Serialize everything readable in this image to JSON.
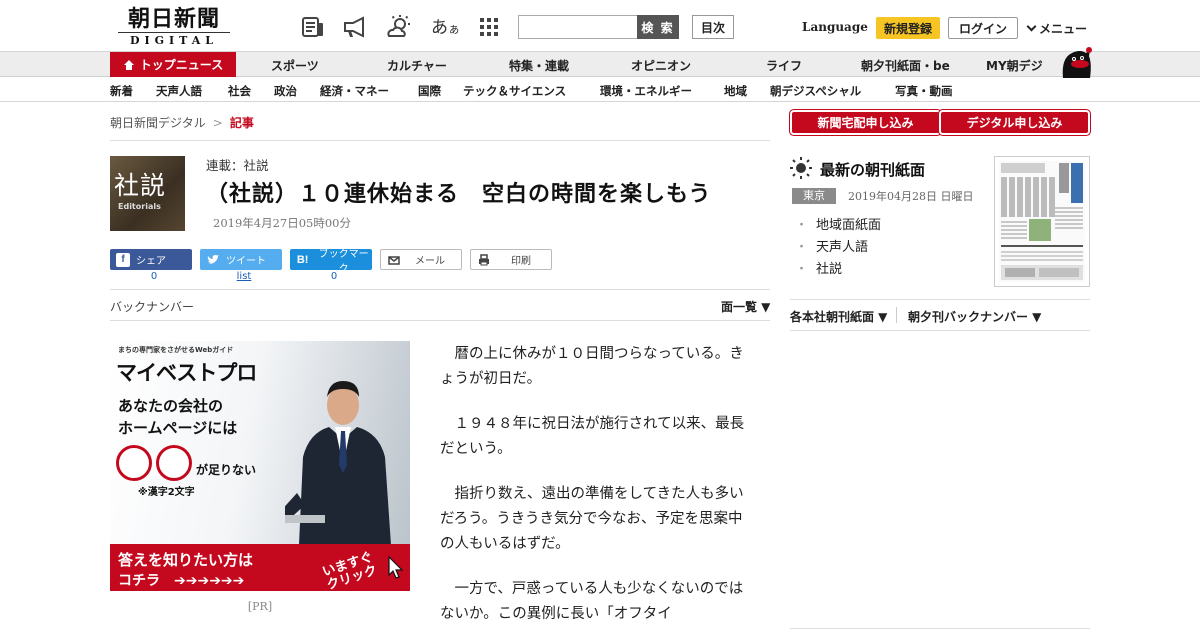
{
  "header": {
    "logo_main": "朝日新聞",
    "logo_sub": "DIGITAL",
    "search_button": "検 索",
    "search_placeholder": "",
    "toc_button": "目次",
    "language": "Language",
    "register": "新規登録",
    "login": "ログイン",
    "menu": "メニュー",
    "font_size_glyph": "あ",
    "font_size_glyph_small": "ぁ",
    "icons": [
      "paper-icon",
      "megaphone-icon",
      "weather-icon",
      "font-size-icon",
      "grid-icon"
    ]
  },
  "nav_primary": {
    "top": "トップニュース",
    "items": [
      "スポーツ",
      "カルチャー",
      "特集・連載",
      "オピニオン",
      "ライフ",
      "朝夕刊紙面・be",
      "MY朝デジ"
    ]
  },
  "nav_secondary": {
    "items": [
      "新着",
      "天声人語",
      "社会",
      "政治",
      "経済・マネー",
      "国際",
      "テック＆サイエンス",
      "環境・エネルギー",
      "地域",
      "朝デジスペシャル",
      "写真・動画"
    ]
  },
  "breadcrumb": {
    "home": "朝日新聞デジタル",
    "separator": ">",
    "current": "記事"
  },
  "article": {
    "badge_kanji": "社説",
    "badge_en": "Editorials",
    "series": "連載：社説",
    "title": "（社説）１０連休始まる　空白の時間を楽しもう",
    "date": "2019年4月27日05時00分",
    "paragraphs": [
      "　暦の上に休みが１０日間つらなっている。きょうが初日だ。",
      "　１９４８年に祝日法が施行されて以来、最長だという。",
      "　指折り数え、遠出の準備をしてきた人も多いだろう。うきうき気分で今なお、予定を思案中の人もいるはずだ。",
      "　一方で、戸惑っている人も少なくないのではないか。この異例に長い「オフタイ"
    ]
  },
  "share": {
    "facebook": {
      "label": "シェア",
      "count": "0"
    },
    "twitter": {
      "label": "ツイート",
      "count": "list"
    },
    "hatena": {
      "label": "ブックマーク",
      "count": "0"
    },
    "mail": {
      "label": "メール"
    },
    "print": {
      "label": "印刷"
    }
  },
  "backnumber": {
    "label": "バックナンバー",
    "pages": "面一覧 ▼"
  },
  "ad": {
    "small": "まちの専門家をさがせるWebガイド",
    "brand": "マイベストプロ",
    "line1": "あなたの会社の",
    "line2": "ホームページには",
    "missing": "が足りない",
    "note": "※漢字2文字",
    "cta1": "答えを知りたい方は",
    "cta2": "コチラ　➔➔➔➔➔➔",
    "click": "いますぐ\nクリック",
    "pr": "[PR]"
  },
  "sidebar": {
    "subscribe_paper": "新聞宅配申し込み",
    "subscribe_digital": "デジタル申し込み",
    "latest_title": "最新の朝刊紙面",
    "region": "東京",
    "date": "2019年04月28日 日曜日",
    "links": [
      "地域面紙面",
      "天声人語",
      "社説"
    ],
    "tab1": "各本社朝刊紙面 ▼",
    "tab2": "朝夕刊バックナンバー ▼"
  },
  "colors": {
    "brand_red": "#c4091e",
    "register_yellow": "#f6c523",
    "facebook": "#3b5998",
    "twitter": "#55acee",
    "hatena": "#1b8fdb"
  }
}
